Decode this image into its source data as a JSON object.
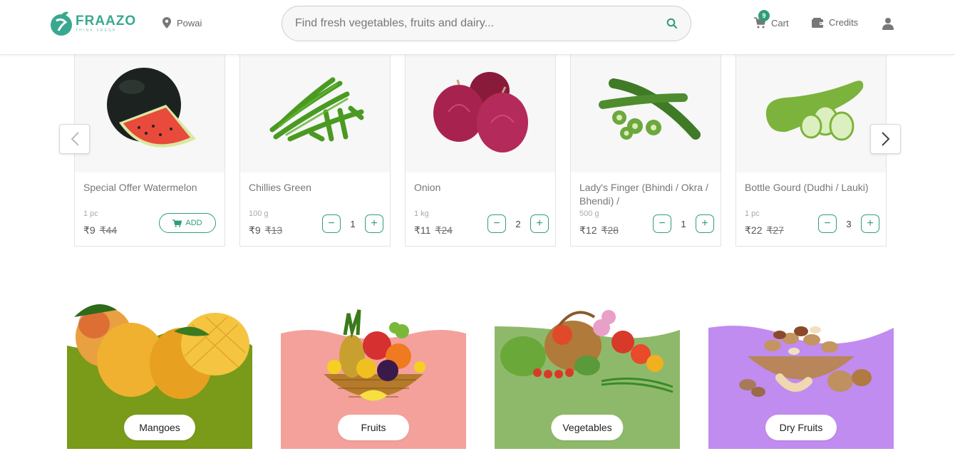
{
  "header": {
    "logo_name": "FRAAZO",
    "logo_tagline": "THINK FRESH",
    "location": "Powai",
    "search_placeholder": "Find fresh vegetables, fruits and dairy...",
    "cart_label": "Cart",
    "cart_count": "9",
    "credits_label": "Credits"
  },
  "products": [
    {
      "name": "Special Offer Watermelon",
      "qty": "1 pc",
      "price": "₹9",
      "mrp": "₹44",
      "action": "add",
      "add_label": "ADD"
    },
    {
      "name": "Chillies Green",
      "qty": "100 g",
      "price": "₹9",
      "mrp": "₹13",
      "action": "stepper",
      "count": "1"
    },
    {
      "name": "Onion",
      "qty": "1 kg",
      "price": "₹11",
      "mrp": "₹24",
      "action": "stepper",
      "count": "2"
    },
    {
      "name": "Lady's Finger (Bhindi / Okra / Bhendi) /",
      "qty": "500 g",
      "price": "₹12",
      "mrp": "₹28",
      "action": "stepper",
      "count": "1"
    },
    {
      "name": "Bottle Gourd (Dudhi / Lauki)",
      "qty": "1 pc",
      "price": "₹22",
      "mrp": "₹27",
      "action": "stepper",
      "count": "3"
    }
  ],
  "categories": [
    {
      "label": "Mangoes",
      "color": "#7a9a1a"
    },
    {
      "label": "Fruits",
      "color": "#f4a19b"
    },
    {
      "label": "Vegetables",
      "color": "#8fb96a"
    },
    {
      "label": "Dry Fruits",
      "color": "#c08cf0"
    }
  ],
  "colors": {
    "accent": "#2e9d7a",
    "logo": "#3aa890"
  }
}
